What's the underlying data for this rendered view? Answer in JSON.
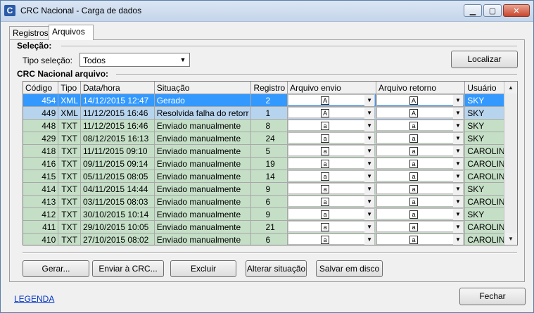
{
  "window": {
    "title": "CRC Nacional - Carga de dados",
    "icon_letter": "C",
    "minimize": "▁",
    "maximize": "▢",
    "close": "✕"
  },
  "tabs": [
    {
      "label": "Registros"
    },
    {
      "label": "Arquivos"
    }
  ],
  "selecao": {
    "heading": "Seleção:",
    "tipo_label": "Tipo seleção:",
    "tipo_value": "Todos"
  },
  "localizar_label": "Localizar",
  "arquivo_heading": "CRC Nacional arquivo:",
  "columns": [
    "Código",
    "Tipo",
    "Data/hora",
    "Situação",
    "Registro",
    "Arquivo envio",
    "Arquivo retorno",
    "Usuário"
  ],
  "rows": [
    {
      "codigo": "454",
      "tipo": "XML",
      "data": "14/12/2015 12:47",
      "situacao": "Gerado",
      "registros": "2",
      "usuario": "SKY",
      "state": "selected",
      "env_icon": "A",
      "ret_icon": "A"
    },
    {
      "codigo": "449",
      "tipo": "XML",
      "data": "11/12/2015 16:46",
      "situacao": "Resolvida falha do retorr",
      "registros": "1",
      "usuario": "SKY",
      "state": "highlight",
      "env_icon": "A",
      "ret_icon": "A"
    },
    {
      "codigo": "448",
      "tipo": "TXT",
      "data": "11/12/2015 16:46",
      "situacao": "Enviado manualmente",
      "registros": "8",
      "usuario": "SKY",
      "state": "ok",
      "env_icon": "a",
      "ret_icon": "a"
    },
    {
      "codigo": "429",
      "tipo": "TXT",
      "data": "08/12/2015 16:13",
      "situacao": "Enviado manualmente",
      "registros": "24",
      "usuario": "SKY",
      "state": "ok",
      "env_icon": "a",
      "ret_icon": "a"
    },
    {
      "codigo": "418",
      "tipo": "TXT",
      "data": "11/11/2015 09:10",
      "situacao": "Enviado manualmente",
      "registros": "5",
      "usuario": "CAROLINE",
      "state": "ok",
      "env_icon": "a",
      "ret_icon": "a"
    },
    {
      "codigo": "416",
      "tipo": "TXT",
      "data": "09/11/2015 09:14",
      "situacao": "Enviado manualmente",
      "registros": "19",
      "usuario": "CAROLINE",
      "state": "ok",
      "env_icon": "a",
      "ret_icon": "a"
    },
    {
      "codigo": "415",
      "tipo": "TXT",
      "data": "05/11/2015 08:05",
      "situacao": "Enviado manualmente",
      "registros": "14",
      "usuario": "CAROLINE",
      "state": "ok",
      "env_icon": "a",
      "ret_icon": "a"
    },
    {
      "codigo": "414",
      "tipo": "TXT",
      "data": "04/11/2015 14:44",
      "situacao": "Enviado manualmente",
      "registros": "9",
      "usuario": "SKY",
      "state": "ok",
      "env_icon": "a",
      "ret_icon": "a"
    },
    {
      "codigo": "413",
      "tipo": "TXT",
      "data": "03/11/2015 08:03",
      "situacao": "Enviado manualmente",
      "registros": "6",
      "usuario": "CAROLINE",
      "state": "ok",
      "env_icon": "a",
      "ret_icon": "a"
    },
    {
      "codigo": "412",
      "tipo": "TXT",
      "data": "30/10/2015 10:14",
      "situacao": "Enviado manualmente",
      "registros": "9",
      "usuario": "SKY",
      "state": "ok",
      "env_icon": "a",
      "ret_icon": "a"
    },
    {
      "codigo": "411",
      "tipo": "TXT",
      "data": "29/10/2015 10:05",
      "situacao": "Enviado manualmente",
      "registros": "21",
      "usuario": "CAROLINE",
      "state": "ok",
      "env_icon": "a",
      "ret_icon": "a"
    },
    {
      "codigo": "410",
      "tipo": "TXT",
      "data": "27/10/2015 08:02",
      "situacao": "Enviado manualmente",
      "registros": "6",
      "usuario": "CAROLINE",
      "state": "ok",
      "env_icon": "a",
      "ret_icon": "a"
    }
  ],
  "actions": {
    "gerar": "Gerar...",
    "enviar": "Enviar à CRC...",
    "excluir": "Excluir",
    "alterar": "Alterar situação",
    "salvar": "Salvar em disco"
  },
  "legenda": "LEGENDA",
  "fechar": "Fechar",
  "colors": {
    "selected": "#3399ff",
    "highlight": "#b7d4ee",
    "ok": "#c5dfc7"
  }
}
